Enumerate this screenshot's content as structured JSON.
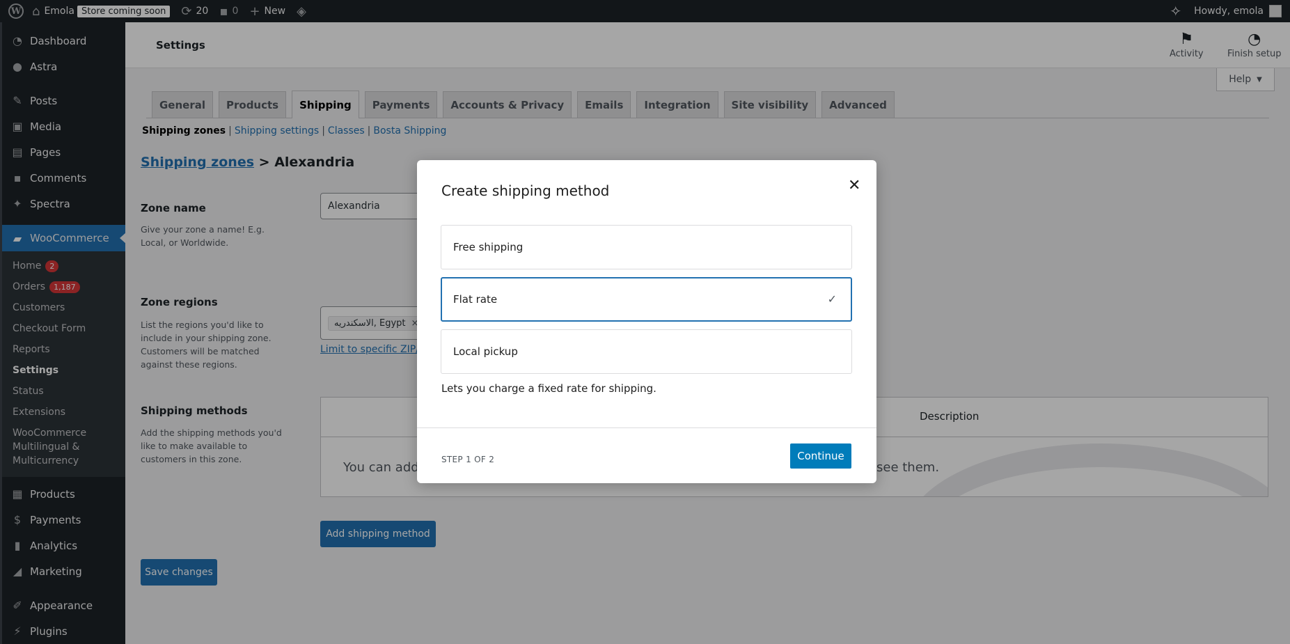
{
  "adminbar": {
    "site_name": "Emola",
    "store_badge": "Store coming soon",
    "updates_count": "20",
    "comments_count": "0",
    "new_label": "New",
    "howdy": "Howdy, emola"
  },
  "sidebar": {
    "items_top": [
      {
        "label": "Dashboard",
        "icon": "dashboard-icon"
      },
      {
        "label": "Astra",
        "icon": "astra-icon"
      },
      {
        "label": "Posts",
        "icon": "pin-icon"
      },
      {
        "label": "Media",
        "icon": "media-icon"
      },
      {
        "label": "Pages",
        "icon": "pages-icon"
      },
      {
        "label": "Comments",
        "icon": "comment-icon"
      },
      {
        "label": "Spectra",
        "icon": "spectra-icon"
      }
    ],
    "woocommerce": "WooCommerce",
    "submenu": [
      {
        "label": "Home",
        "badge": "2"
      },
      {
        "label": "Orders",
        "badge": "1,187"
      },
      {
        "label": "Customers"
      },
      {
        "label": "Checkout Form"
      },
      {
        "label": "Reports"
      },
      {
        "label": "Settings"
      },
      {
        "label": "Status"
      },
      {
        "label": "Extensions"
      },
      {
        "label": "WooCommerce Multilingual & Multicurrency"
      }
    ],
    "items_bottom": [
      {
        "label": "Products"
      },
      {
        "label": "Payments"
      },
      {
        "label": "Analytics"
      },
      {
        "label": "Marketing"
      },
      {
        "label": "Appearance"
      },
      {
        "label": "Plugins"
      }
    ]
  },
  "header": {
    "title": "Settings",
    "activity": "Activity",
    "finish_setup": "Finish setup",
    "help": "Help"
  },
  "tabs": [
    "General",
    "Products",
    "Shipping",
    "Payments",
    "Accounts & Privacy",
    "Emails",
    "Integration",
    "Site visibility",
    "Advanced"
  ],
  "active_tab": "Shipping",
  "subsub": {
    "current": "Shipping zones",
    "links": [
      "Shipping settings",
      "Classes",
      "Bosta Shipping"
    ],
    "separator": "|"
  },
  "breadcrumb": {
    "link": "Shipping zones",
    "arrow": ">",
    "current": "Alexandria"
  },
  "zone_name": {
    "label": "Zone name",
    "desc": "Give your zone a name! E.g. Local, or Worldwide.",
    "value": "Alexandria"
  },
  "zone_regions": {
    "label": "Zone regions",
    "desc": "List the regions you'd like to include in your shipping zone. Customers will be matched against these regions.",
    "chip": "الاسكندريه, Egypt",
    "limit_link": "Limit to specific ZIP/po"
  },
  "shipping_methods": {
    "label": "Shipping methods",
    "desc": "Add the shipping methods you'd like to make available to customers in this zone.",
    "col_description": "Description",
    "empty_left": "You can add r",
    "empty_right": "see them.",
    "add_button": "Add shipping method"
  },
  "save_button": "Save changes",
  "modal": {
    "title": "Create shipping method",
    "options": [
      {
        "label": "Free shipping",
        "selected": false
      },
      {
        "label": "Flat rate",
        "selected": true
      },
      {
        "label": "Local pickup",
        "selected": false
      }
    ],
    "description": "Lets you charge a fixed rate for shipping.",
    "step": "STEP 1 OF 2",
    "continue": "Continue"
  },
  "colors": {
    "accent": "#2271b1",
    "button": "#007cba",
    "sidebar": "#1d2327",
    "badge": "#d63638"
  }
}
